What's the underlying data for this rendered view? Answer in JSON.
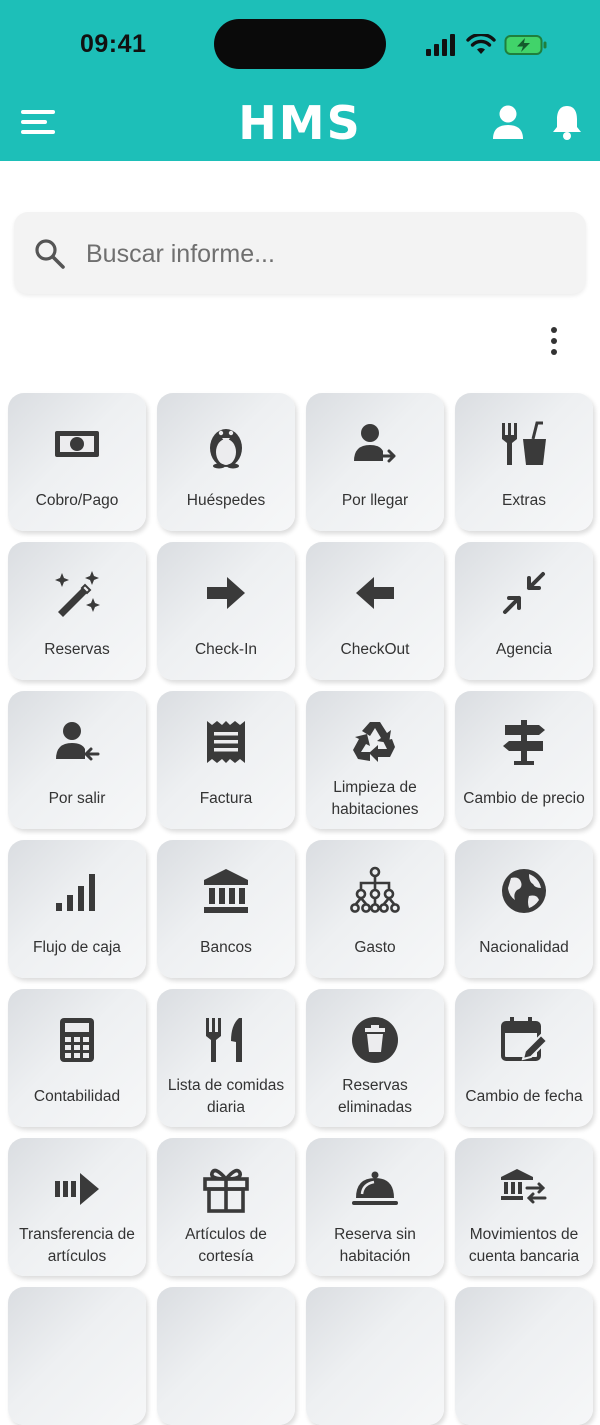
{
  "status_bar": {
    "time": "09:41"
  },
  "app_bar": {
    "logo": "HMS"
  },
  "search": {
    "placeholder": "Buscar informe..."
  },
  "tiles": [
    {
      "label": "Cobro/Pago",
      "icon": "money-icon"
    },
    {
      "label": "Huéspedes",
      "icon": "penguin-icon"
    },
    {
      "label": "Por llegar",
      "icon": "user-arrow-right-icon"
    },
    {
      "label": "Extras",
      "icon": "food-drink-icon"
    },
    {
      "label": "Reservas",
      "icon": "magic-wand-icon"
    },
    {
      "label": "Check-In",
      "icon": "arrow-right-icon"
    },
    {
      "label": "CheckOut",
      "icon": "arrow-left-icon"
    },
    {
      "label": "Agencia",
      "icon": "compress-icon"
    },
    {
      "label": "Por salir",
      "icon": "user-arrow-left-icon"
    },
    {
      "label": "Factura",
      "icon": "receipt-icon"
    },
    {
      "label": "Limpieza de habitaciones",
      "icon": "recycle-icon"
    },
    {
      "label": "Cambio de precio",
      "icon": "signpost-icon"
    },
    {
      "label": "Flujo de caja",
      "icon": "signal-bars-icon"
    },
    {
      "label": "Bancos",
      "icon": "bank-icon"
    },
    {
      "label": "Gasto",
      "icon": "hierarchy-icon"
    },
    {
      "label": "Nacionalidad",
      "icon": "globe-icon"
    },
    {
      "label": "Contabilidad",
      "icon": "calculator-icon"
    },
    {
      "label": "Lista de comidas diaria",
      "icon": "utensils-icon"
    },
    {
      "label": "Reservas eliminadas",
      "icon": "trash-circle-icon"
    },
    {
      "label": "Cambio de fecha",
      "icon": "calendar-edit-icon"
    },
    {
      "label": "Transferencia de artículos",
      "icon": "transfer-arrow-icon"
    },
    {
      "label": "Artículos de cortesía",
      "icon": "gift-icon"
    },
    {
      "label": "Reserva sin habitación",
      "icon": "cloche-icon"
    },
    {
      "label": "Movimientos de cuenta bancaria",
      "icon": "bank-transfer-icon"
    },
    {
      "label": "",
      "icon": ""
    },
    {
      "label": "",
      "icon": ""
    },
    {
      "label": "",
      "icon": ""
    },
    {
      "label": "",
      "icon": ""
    }
  ]
}
